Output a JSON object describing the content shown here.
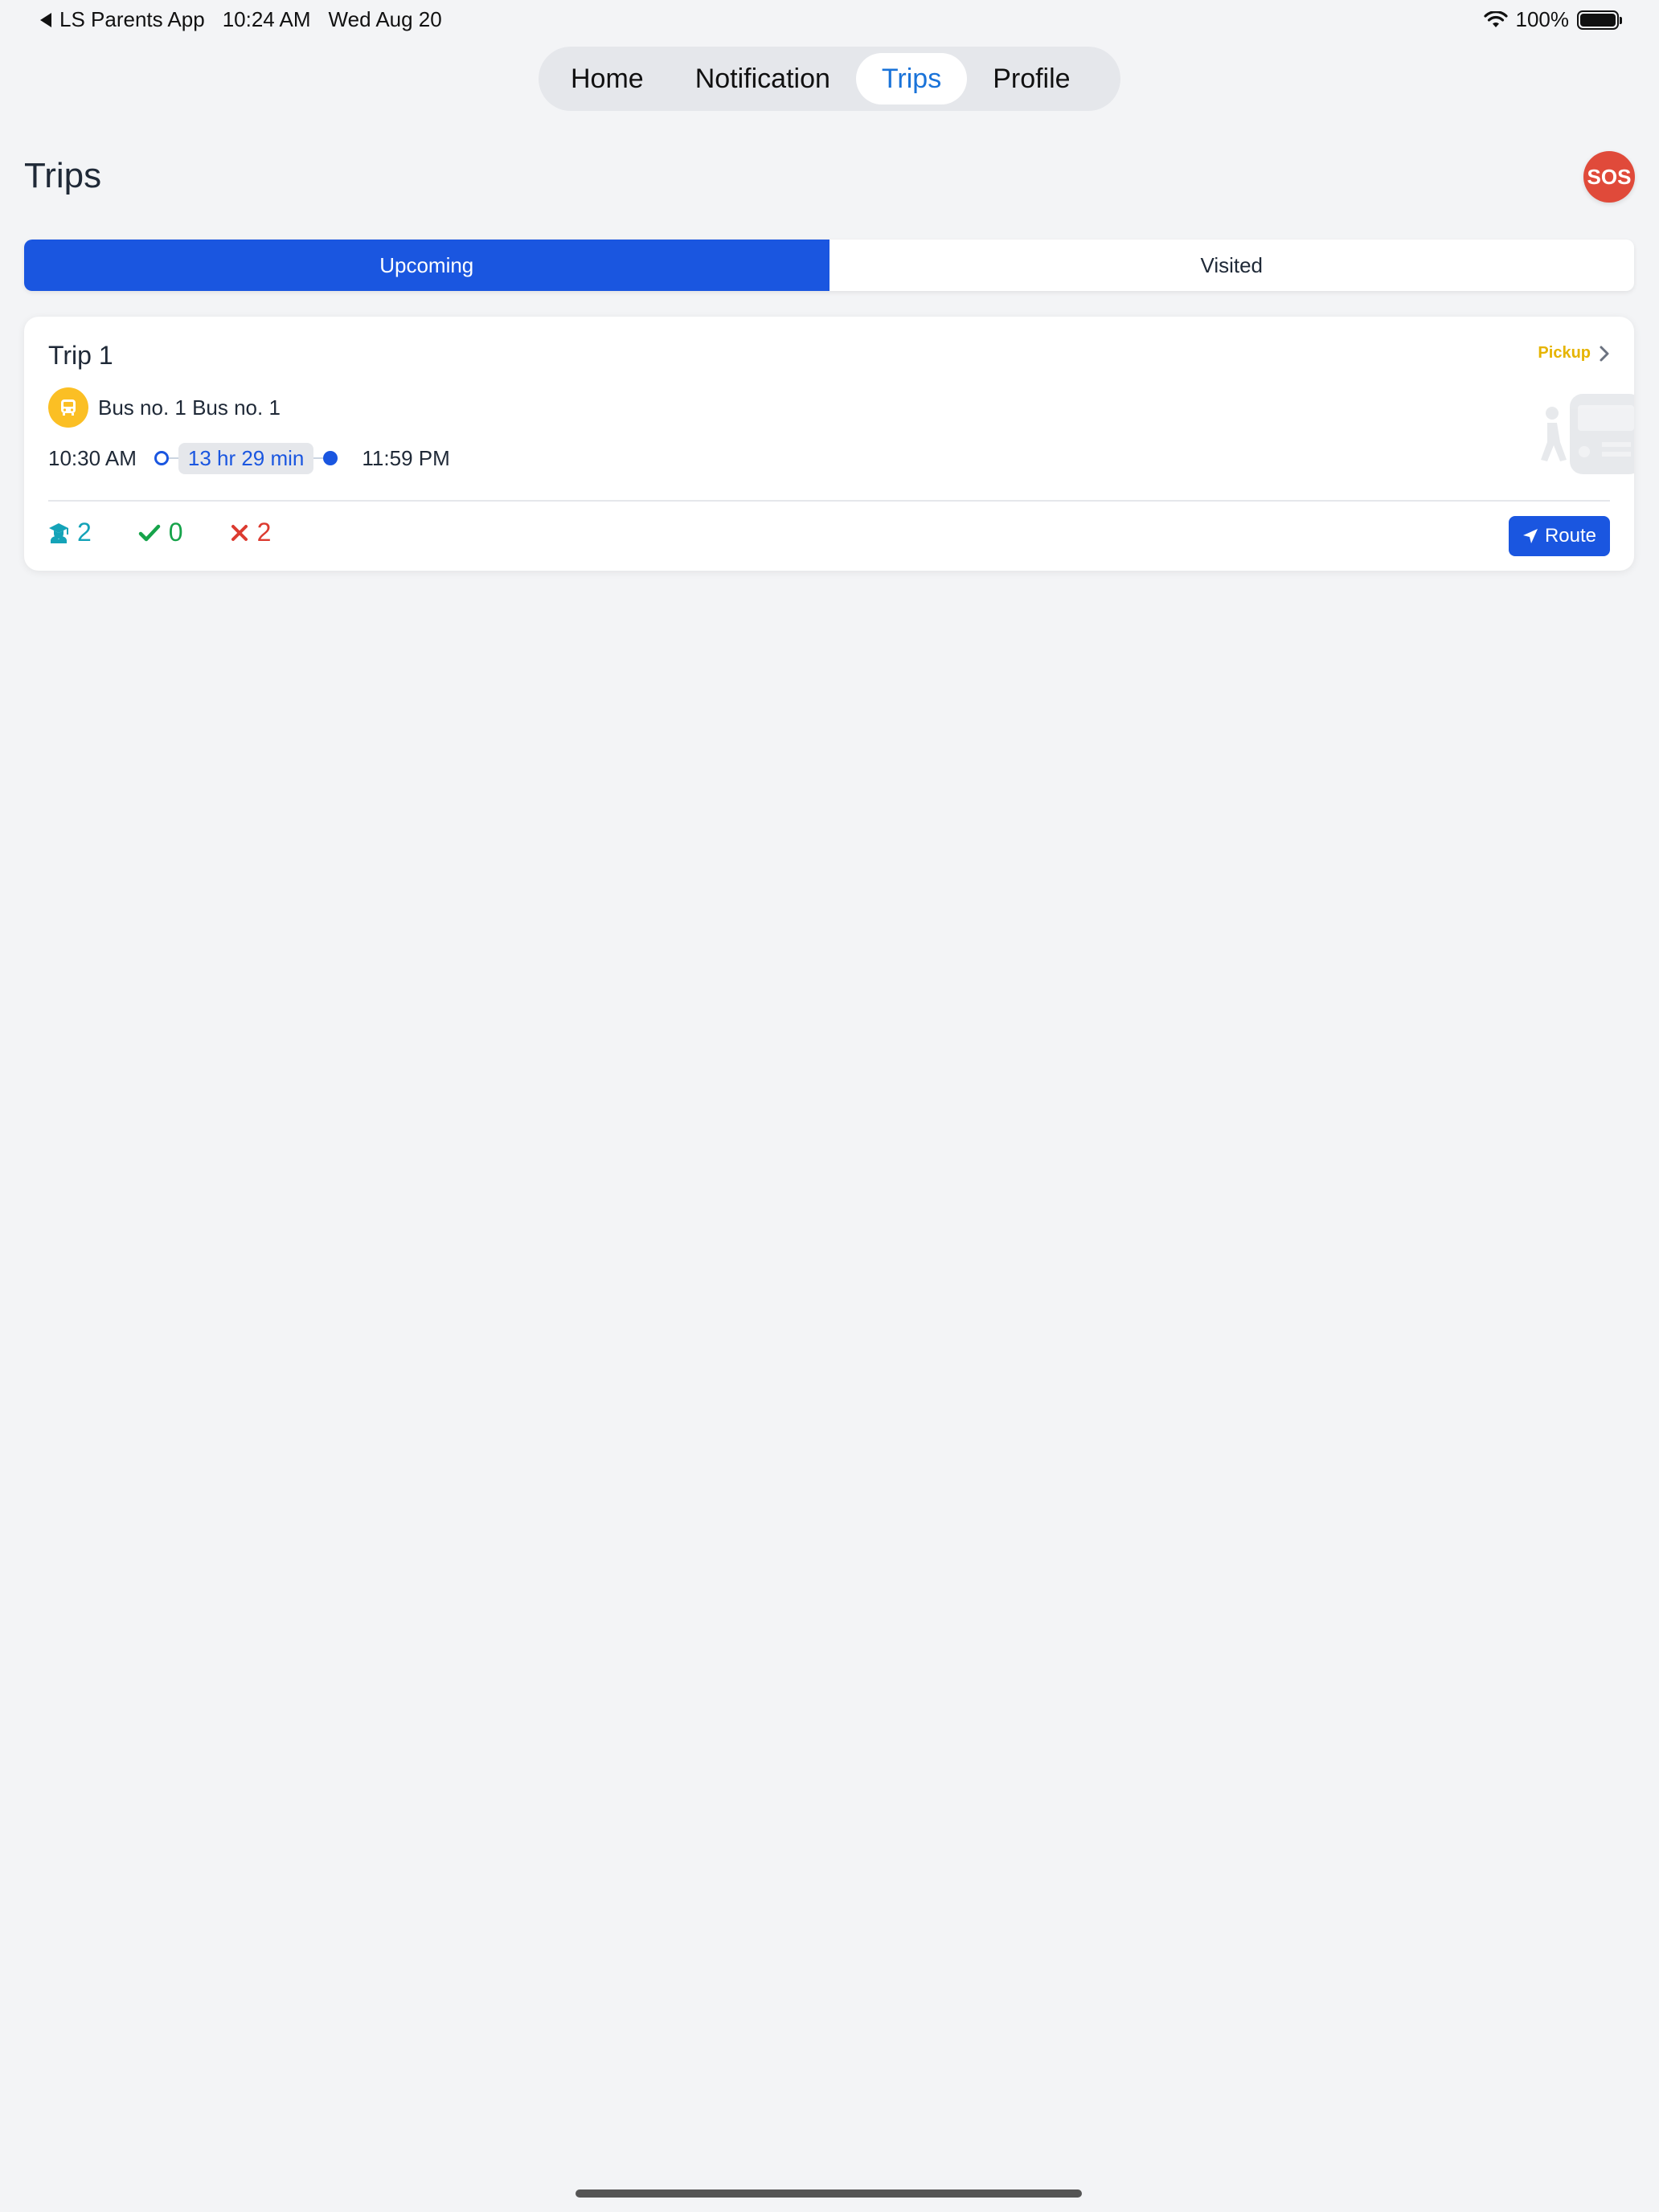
{
  "status_bar": {
    "back_app": "LS Parents App",
    "time": "10:24 AM",
    "date": "Wed Aug 20",
    "battery": "100%"
  },
  "top_nav": {
    "items": [
      {
        "label": "Home",
        "active": false
      },
      {
        "label": "Notification",
        "active": false
      },
      {
        "label": "Trips",
        "active": true
      },
      {
        "label": "Profile",
        "active": false
      }
    ]
  },
  "header": {
    "title": "Trips",
    "sos_label": "SOS"
  },
  "tabs": {
    "items": [
      {
        "label": "Upcoming",
        "active": true
      },
      {
        "label": "Visited",
        "active": false
      }
    ]
  },
  "trip": {
    "title": "Trip 1",
    "type": "Pickup",
    "bus": "Bus no. 1 Bus no. 1",
    "start_time": "10:30 AM",
    "duration": "13 hr 29 min",
    "end_time": "11:59 PM",
    "stats": {
      "total": "2",
      "completed": "0",
      "missed": "2"
    },
    "route_label": "Route"
  },
  "colors": {
    "primary": "#1a56e0",
    "sos": "#e04a3a",
    "pickup": "#e6b400",
    "total": "#14a3b8",
    "completed": "#16a34a",
    "missed": "#dc3b30"
  }
}
